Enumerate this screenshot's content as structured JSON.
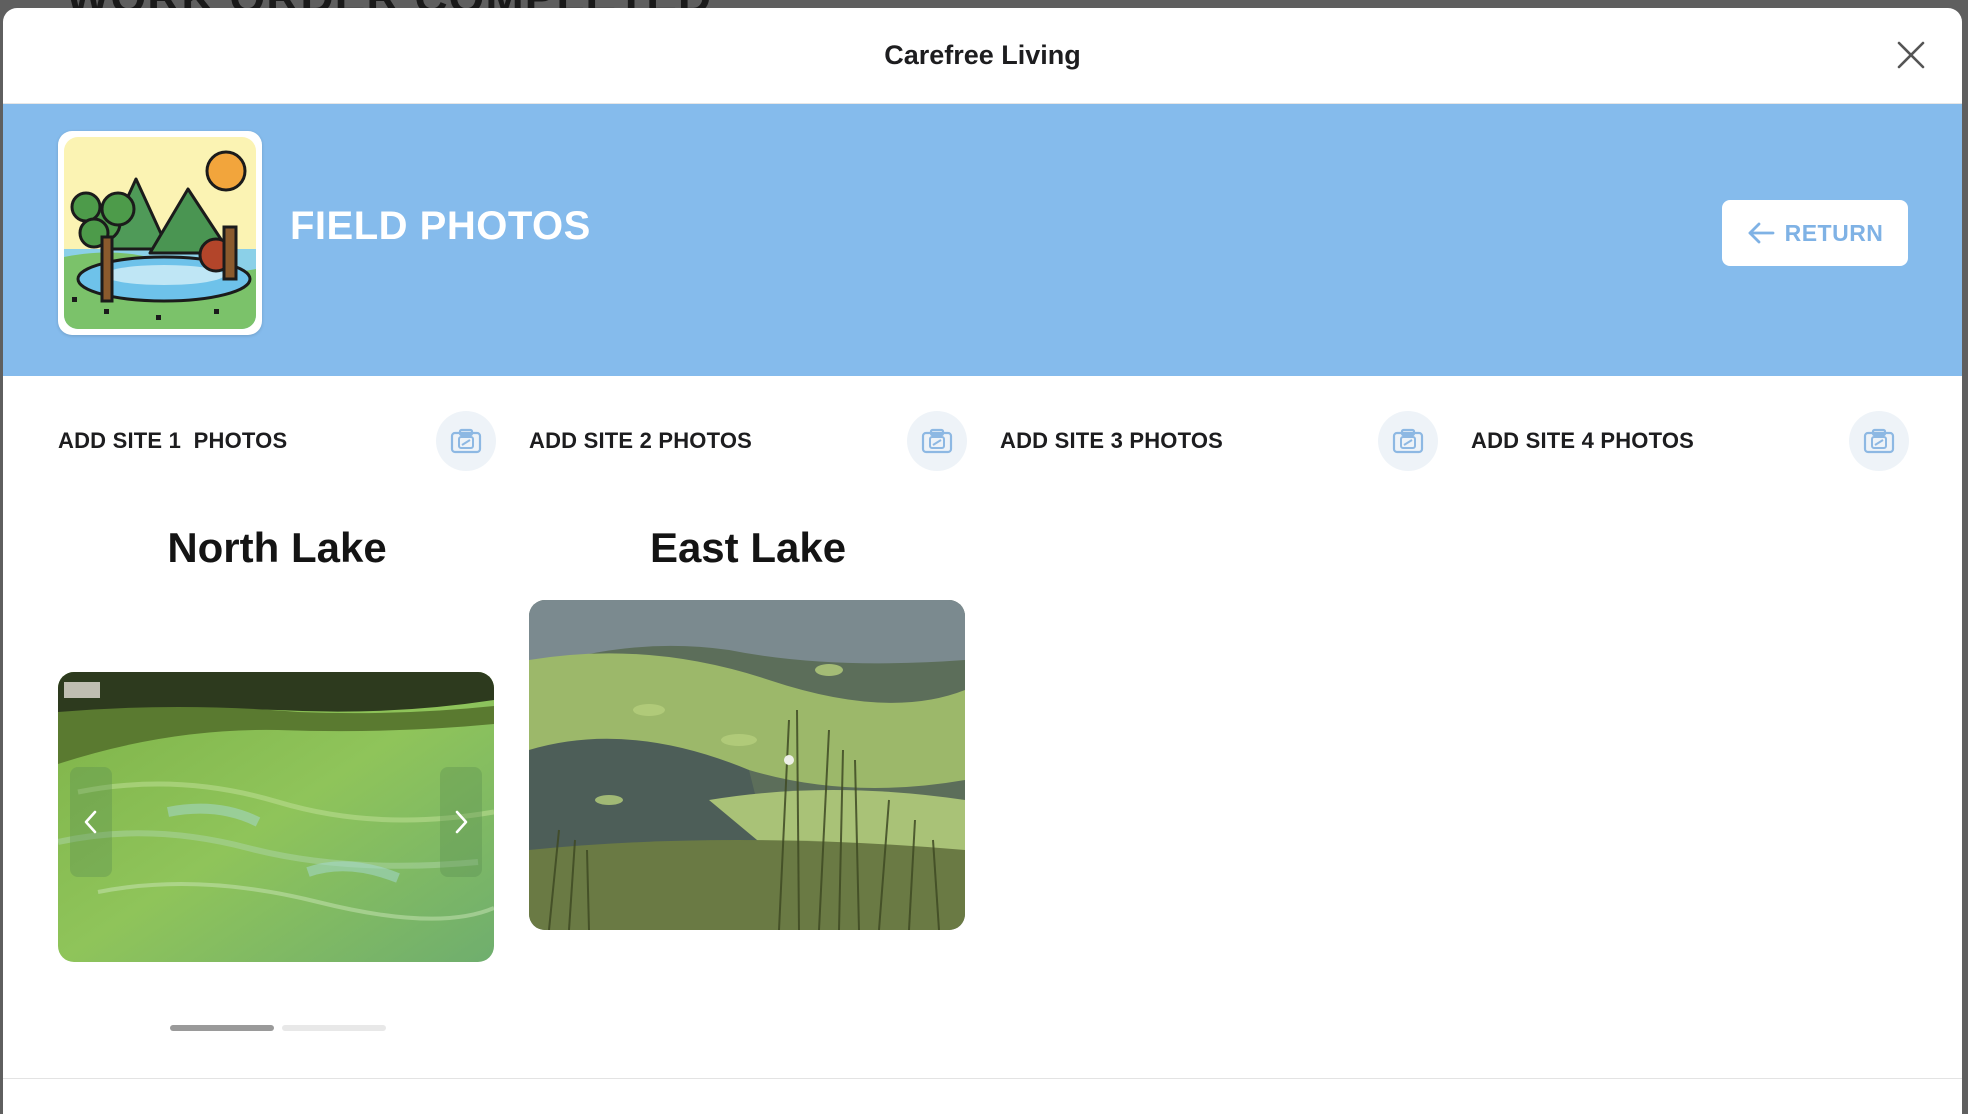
{
  "background": {
    "title_fragment": "WORK ORDER COMPLETED"
  },
  "modal": {
    "title": "Carefree Living",
    "close_icon": "close-icon"
  },
  "banner": {
    "title": "FIELD PHOTOS",
    "logo_icon": "lake-landscape-icon",
    "return_label": "RETURN",
    "return_icon": "arrow-left-icon",
    "background_color": "#85bbec"
  },
  "sites": [
    {
      "label": "ADD SITE 1  PHOTOS",
      "icon": "camera-icon"
    },
    {
      "label": "ADD SITE 2 PHOTOS",
      "icon": "camera-icon"
    },
    {
      "label": "ADD SITE 3 PHOTOS",
      "icon": "camera-icon"
    },
    {
      "label": "ADD SITE 4 PHOTOS",
      "icon": "camera-icon"
    }
  ],
  "galleries": [
    {
      "title": "North Lake",
      "has_carousel": true,
      "carousel_pages": 2,
      "carousel_active_index": 0
    },
    {
      "title": "East Lake",
      "has_carousel": false
    }
  ]
}
